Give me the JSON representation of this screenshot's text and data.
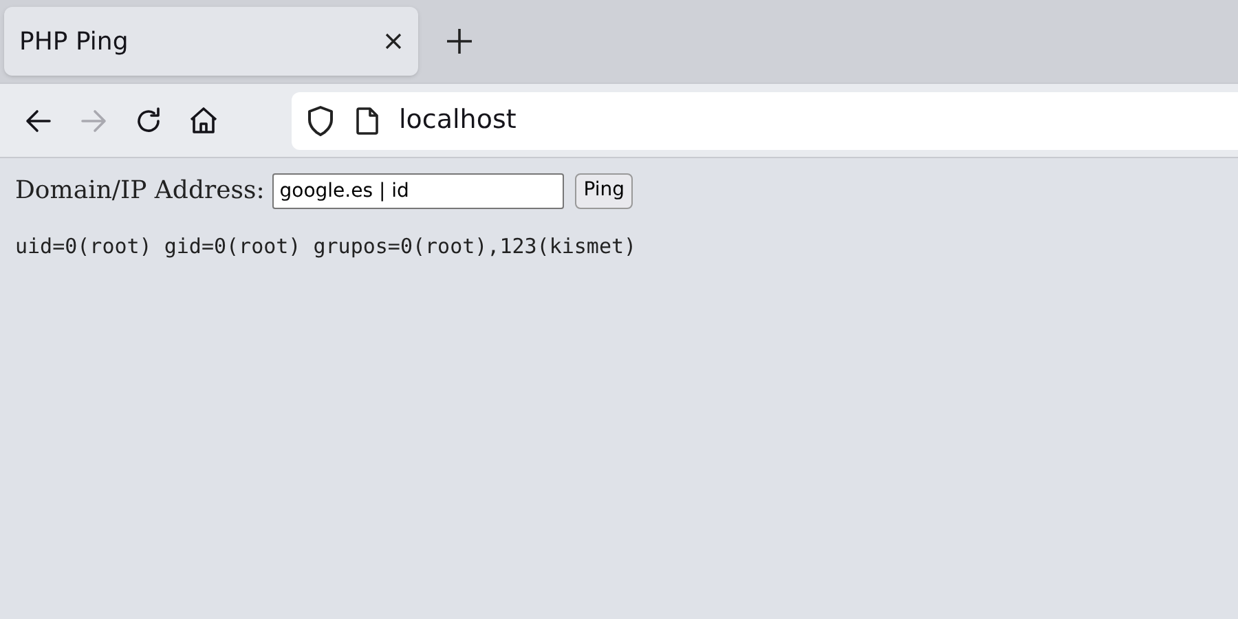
{
  "tabs": [
    {
      "title": "PHP Ping",
      "selected": true
    }
  ],
  "nav_buttons": [
    {
      "kind": "back",
      "disabled": false
    },
    {
      "kind": "forward",
      "disabled": true
    },
    {
      "kind": "reload",
      "disabled": false
    },
    {
      "kind": "home",
      "disabled": false
    }
  ],
  "address_bar": {
    "url": "localhost"
  },
  "page": {
    "label": "Domain/IP Address:",
    "input_value": "google.es | id",
    "button": "Ping",
    "output": "uid=0(root) gid=0(root) grupos=0(root),123(kismet)"
  }
}
